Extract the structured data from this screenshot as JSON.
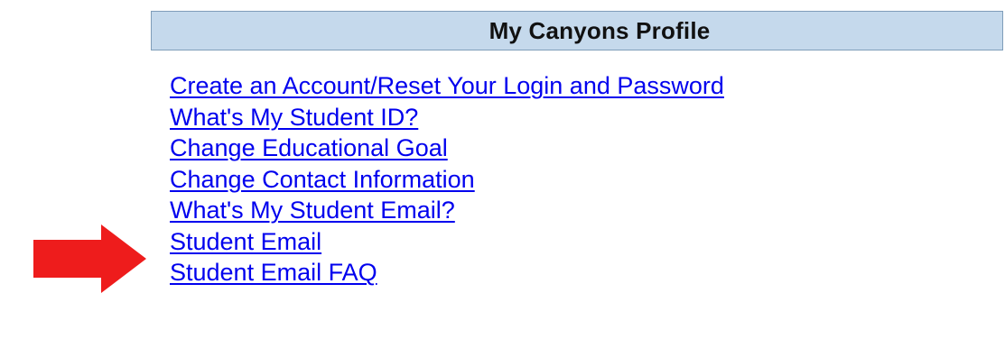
{
  "header": {
    "title": "My Canyons Profile"
  },
  "links": [
    "Create an Account/Reset Your Login and Password",
    "What's My Student ID?",
    "Change Educational Goal",
    "Change Contact Information",
    "What's My Student Email?",
    "Student Email",
    "Student Email FAQ"
  ],
  "colors": {
    "header_bg": "#c5d9ec",
    "header_border": "#7f9db9",
    "link": "#0000ee",
    "arrow": "#ee1c1c"
  },
  "annotation": {
    "icon": "red-arrow-icon",
    "points_to": "What's My Student Email?"
  }
}
